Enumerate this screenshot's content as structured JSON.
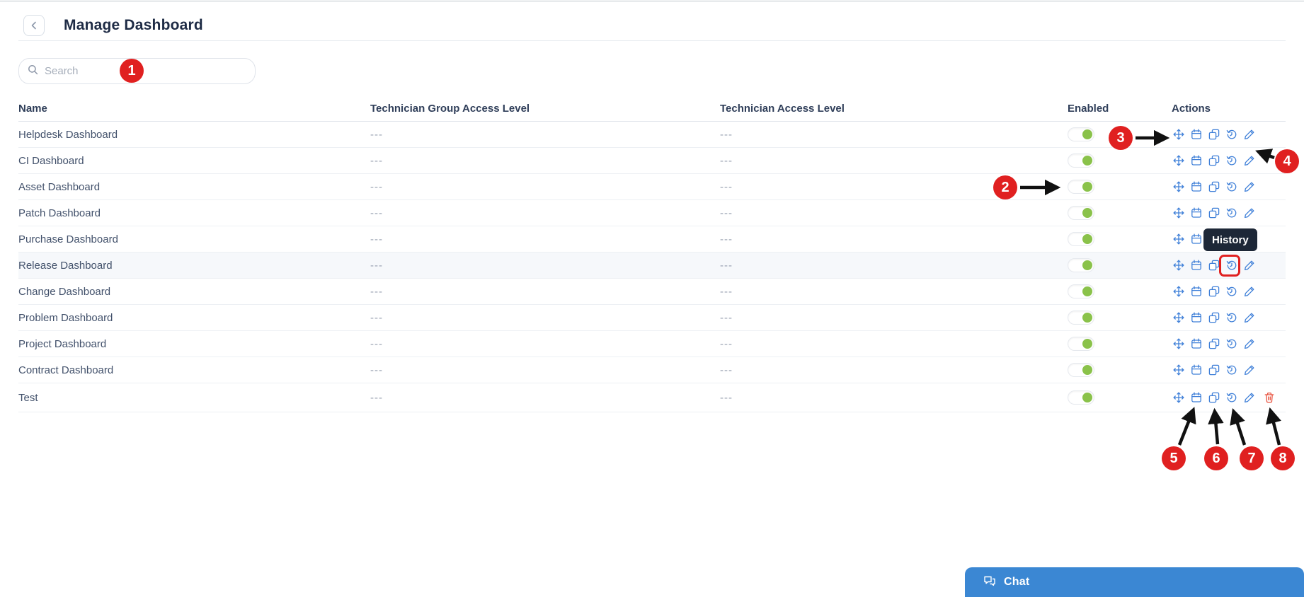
{
  "page": {
    "title": "Manage Dashboard"
  },
  "search": {
    "placeholder": "Search"
  },
  "table": {
    "columns": {
      "name": "Name",
      "group_access": "Technician Group Access Level",
      "access": "Technician Access Level",
      "enabled": "Enabled",
      "actions": "Actions"
    },
    "rows": [
      {
        "name": "Helpdesk Dashboard",
        "group_access": "---",
        "access": "---",
        "enabled": true,
        "actions": [
          "move-icon",
          "calendar-icon",
          "copy-icon",
          "history-icon",
          "edit-icon"
        ]
      },
      {
        "name": "CI Dashboard",
        "group_access": "---",
        "access": "---",
        "enabled": true,
        "actions": [
          "move-icon",
          "calendar-icon",
          "copy-icon",
          "history-icon",
          "edit-icon"
        ]
      },
      {
        "name": "Asset Dashboard",
        "group_access": "---",
        "access": "---",
        "enabled": true,
        "actions": [
          "move-icon",
          "calendar-icon",
          "copy-icon",
          "history-icon",
          "edit-icon"
        ]
      },
      {
        "name": "Patch Dashboard",
        "group_access": "---",
        "access": "---",
        "enabled": true,
        "actions": [
          "move-icon",
          "calendar-icon",
          "copy-icon",
          "history-icon",
          "edit-icon"
        ]
      },
      {
        "name": "Purchase Dashboard",
        "group_access": "---",
        "access": "---",
        "enabled": true,
        "actions": [
          "move-icon",
          "calendar-icon",
          "copy-icon",
          "history-icon",
          "edit-icon"
        ]
      },
      {
        "name": "Release Dashboard",
        "group_access": "---",
        "access": "---",
        "enabled": true,
        "highlighted": true,
        "actions": [
          "move-icon",
          "calendar-icon",
          "copy-icon",
          "history-icon",
          "edit-icon"
        ]
      },
      {
        "name": "Change Dashboard",
        "group_access": "---",
        "access": "---",
        "enabled": true,
        "actions": [
          "move-icon",
          "calendar-icon",
          "copy-icon",
          "history-icon",
          "edit-icon"
        ]
      },
      {
        "name": "Problem Dashboard",
        "group_access": "---",
        "access": "---",
        "enabled": true,
        "actions": [
          "move-icon",
          "calendar-icon",
          "copy-icon",
          "history-icon",
          "edit-icon"
        ]
      },
      {
        "name": "Project Dashboard",
        "group_access": "---",
        "access": "---",
        "enabled": true,
        "actions": [
          "move-icon",
          "calendar-icon",
          "copy-icon",
          "history-icon",
          "edit-icon"
        ]
      },
      {
        "name": "Contract Dashboard",
        "group_access": "---",
        "access": "---",
        "enabled": true,
        "actions": [
          "move-icon",
          "calendar-icon",
          "copy-icon",
          "history-icon",
          "edit-icon"
        ]
      },
      {
        "name": "Test",
        "group_access": "---",
        "access": "---",
        "enabled": true,
        "actions": [
          "move-icon",
          "calendar-icon",
          "copy-icon",
          "history-icon",
          "edit-icon",
          "delete-icon"
        ]
      }
    ]
  },
  "tooltip": {
    "text": "History"
  },
  "annotations": {
    "badges": [
      {
        "label": "1"
      },
      {
        "label": "2"
      },
      {
        "label": "3"
      },
      {
        "label": "4"
      },
      {
        "label": "5"
      },
      {
        "label": "6"
      },
      {
        "label": "7"
      },
      {
        "label": "8"
      }
    ]
  },
  "chat": {
    "label": "Chat"
  },
  "colors": {
    "accent_blue": "#3e7fd8",
    "toggle_green": "#8ac24a",
    "annotation_red": "#e02020",
    "danger_red": "#e8503c",
    "tooltip_bg": "#1d2737",
    "chat_blue": "#3b87d3"
  }
}
